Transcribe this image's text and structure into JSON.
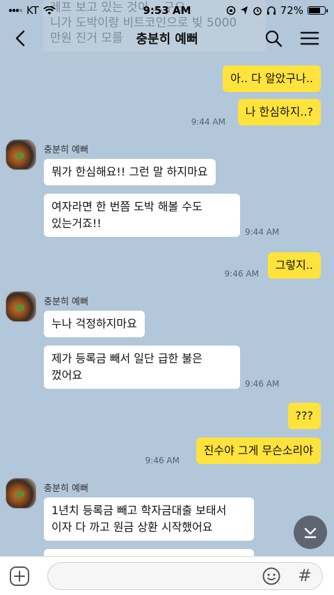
{
  "status_bar": {
    "carrier": "KT",
    "time": "9:53 AM",
    "battery": "72%",
    "battery_level": 0.72
  },
  "ghost_overlay": {
    "lines": [
      "레프 보고 있는 것이 ...구요",
      "니가 도박이랑 비트코인으로 빚 5000",
      "만원 진거 모를"
    ]
  },
  "header": {
    "title": "충분히 예뻐",
    "back_icon": "chevron-left-icon",
    "search_icon": "search-icon",
    "menu_icon": "hamburger-menu-icon"
  },
  "messages": [
    {
      "from": "me",
      "text": "아.. 다 알았구나.."
    },
    {
      "from": "me",
      "text": "나 한심하지..?",
      "time": "9:44 AM"
    },
    {
      "from": "other",
      "sender": "충분히 예뻐",
      "text": "뭐가 한심해요!! 그런 말 하지마요"
    },
    {
      "from": "other",
      "text": "여자라면 한 번쯤 도박 해볼 수도\n있는거죠!!",
      "time": "9:44 AM"
    },
    {
      "from": "me",
      "text": "그렇지..",
      "time": "9:46 AM"
    },
    {
      "from": "other",
      "sender": "충분히 예뻐",
      "text": "누나 걱정하지마요"
    },
    {
      "from": "other",
      "text": "제가 등록금 빼서 일단 급한 불은\n껐어요",
      "time": "9:46 AM"
    },
    {
      "from": "me",
      "text": "???"
    },
    {
      "from": "me",
      "text": "진수야 그게 무슨소리야",
      "time": "9:46 AM"
    },
    {
      "from": "other",
      "sender": "충분히 예뻐",
      "text": "1년치 등록금 빼고 학자금대출 보태서\n이자 다 까고 원금 상환 시작했어요"
    }
  ],
  "input_bar": {
    "placeholder": "",
    "plus_icon": "plus-square-icon",
    "emoji_icon": "smiley-icon",
    "hash_label": "#"
  },
  "scroll_down_icon": "chevron-down-icon"
}
